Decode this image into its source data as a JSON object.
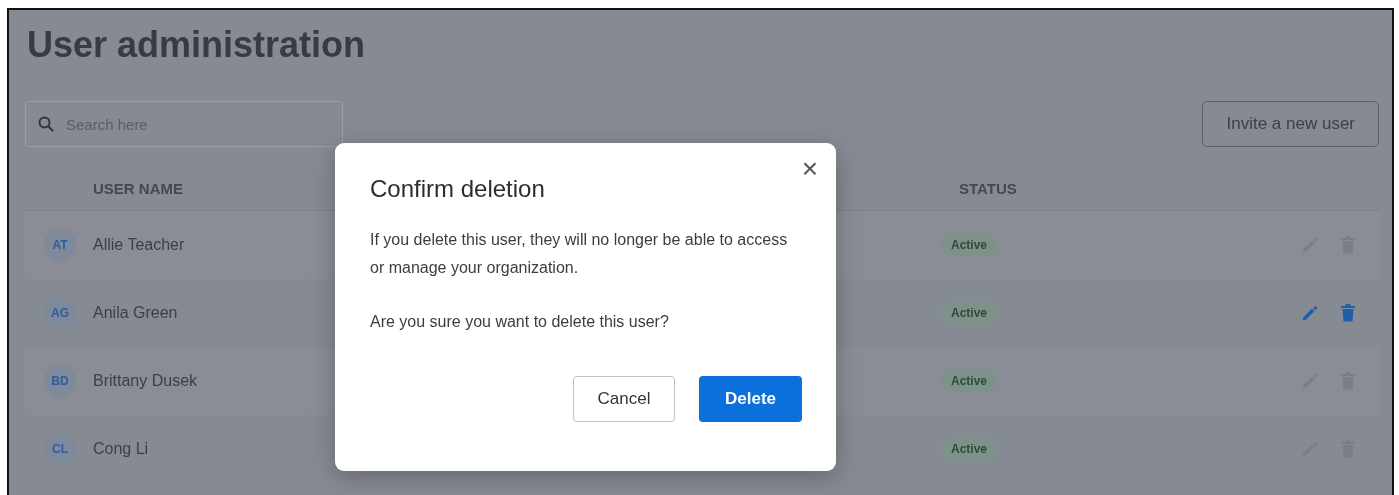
{
  "page": {
    "title": "User administration"
  },
  "search": {
    "placeholder": "Search here"
  },
  "invite_button": "Invite a new user",
  "table": {
    "columns": [
      "USER NAME",
      "STATUS"
    ],
    "rows": [
      {
        "initials": "AT",
        "name": "Allie Teacher",
        "status": "Active",
        "hovered": false
      },
      {
        "initials": "AG",
        "name": "Anila Green",
        "status": "Active",
        "hovered": true
      },
      {
        "initials": "BD",
        "name": "Brittany Dusek",
        "status": "Active",
        "hovered": false
      },
      {
        "initials": "CL",
        "name": "Cong Li",
        "status": "Active",
        "hovered": false
      }
    ]
  },
  "dialog": {
    "title": "Confirm deletion",
    "paragraphs": [
      "If you delete this user, they will no longer be able to access or manage your organization.",
      "Are you sure you want to delete this user?"
    ],
    "close": "×",
    "buttons": [
      {
        "label": "Cancel",
        "kind": "secondary"
      },
      {
        "label": "Delete",
        "kind": "primary"
      }
    ]
  }
}
